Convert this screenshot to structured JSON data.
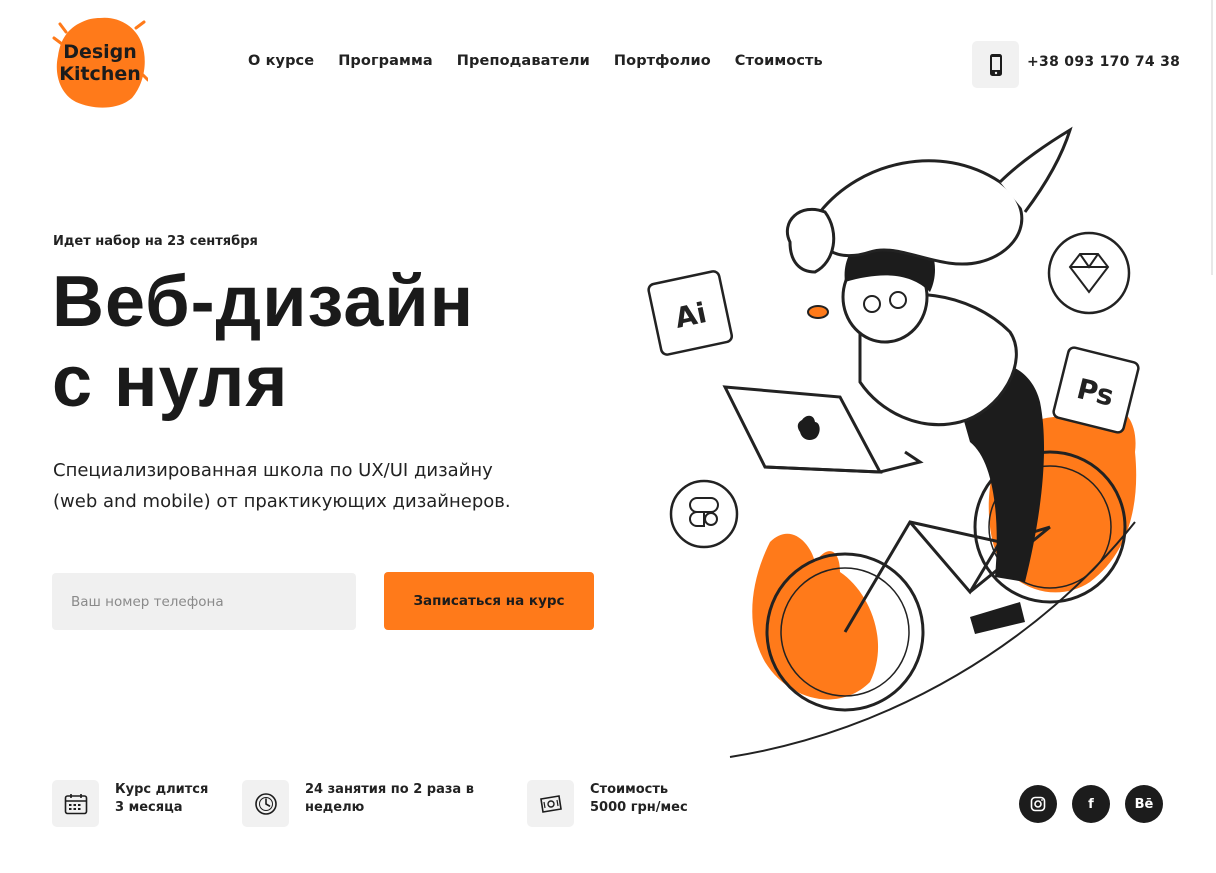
{
  "brand": {
    "logo_line1": "Design",
    "logo_line2": "Kitchen",
    "accent": "#ff7a1a",
    "dark": "#1c1c1c"
  },
  "nav": {
    "items": [
      {
        "label": "О курсе"
      },
      {
        "label": "Программа"
      },
      {
        "label": "Преподаватели"
      },
      {
        "label": "Портфолио"
      },
      {
        "label": "Стоимость"
      }
    ]
  },
  "header": {
    "phone_icon": "smartphone-icon",
    "phone": "+38 093 170 74 38"
  },
  "hero": {
    "subtitle": "Идет набор на 23 сентября",
    "title_line1": "Веб-дизайн",
    "title_line2": "с нуля",
    "desc_line1": "Специализированная школа по UX/UI дизайну",
    "desc_line2": "(web and mobile) от практикующих дизайнеров.",
    "input_placeholder": "Ваш номер телефона",
    "cta_label": "Записаться на курс"
  },
  "illustration": {
    "badges": [
      "Ai",
      "Ps"
    ],
    "icons": [
      "sketch-icon",
      "figma-icon",
      "apple-logo-icon"
    ]
  },
  "features": [
    {
      "icon": "calendar-icon",
      "line1": "Курс длится",
      "line2": "3 месяца"
    },
    {
      "icon": "clock-icon",
      "line1": "24 занятия по 2 раза в",
      "line2": "неделю"
    },
    {
      "icon": "money-icon",
      "line1": "Стоимость",
      "line2": "5000 грн/мес"
    }
  ],
  "social": {
    "instagram_icon": "instagram-icon",
    "facebook_label": "f",
    "behance_label": "Bē"
  }
}
